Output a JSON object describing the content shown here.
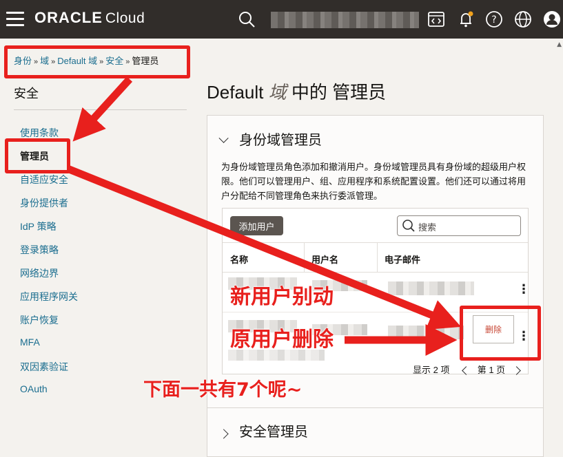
{
  "topbar": {
    "logo_brand": "ORACLE",
    "logo_product": "Cloud"
  },
  "breadcrumb": [
    {
      "label": "身份"
    },
    {
      "label": "域"
    },
    {
      "label": "Default 域"
    },
    {
      "label": "安全"
    },
    {
      "label": "管理员"
    }
  ],
  "sidebar": {
    "title": "安全",
    "items": [
      {
        "label": "使用条款"
      },
      {
        "label": "管理员"
      },
      {
        "label": "自适应安全"
      },
      {
        "label": "身份提供者"
      },
      {
        "label": "IdP 策略"
      },
      {
        "label": "登录策略"
      },
      {
        "label": "网络边界"
      },
      {
        "label": "应用程序网关"
      },
      {
        "label": "账户恢复"
      },
      {
        "label": "MFA"
      },
      {
        "label": "双因素验证"
      },
      {
        "label": "OAuth"
      }
    ]
  },
  "main": {
    "title_prefix": "Default",
    "title_em": "域",
    "title_suffix": "中的 管理员",
    "sections": [
      {
        "title": "身份域管理员",
        "description": "为身份域管理员角色添加和撤消用户。身份域管理员具有身份域的超级用户权限。他们可以管理用户、组、应用程序和系统配置设置。他们还可以通过将用户分配给不同管理角色来执行委派管理。",
        "add_button": "添加用户",
        "search_placeholder": "搜索",
        "columns": [
          "名称",
          "用户名",
          "电子邮件"
        ],
        "delete_button": "删除",
        "pager_count": "显示 2 项",
        "pager_page": "第 1 页"
      },
      {
        "title": "安全管理员"
      }
    ]
  },
  "annotations": {
    "new_user": "新用户别动",
    "old_user": "原用户删除",
    "note": "下面一共有7个呢~"
  },
  "colors": {
    "annotation": "#e8201d",
    "link": "#1a6d8f",
    "topbar": "#312d2a"
  }
}
